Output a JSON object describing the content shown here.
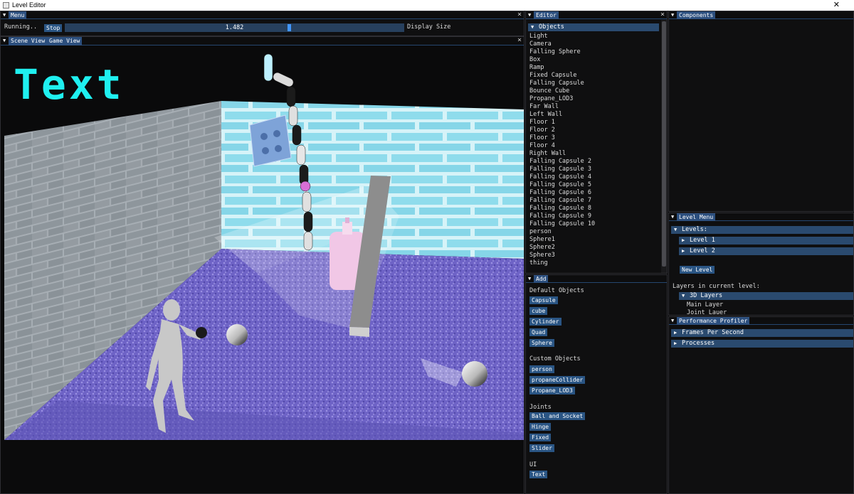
{
  "window": {
    "title": "Level Editor",
    "close": "✕"
  },
  "menu_panel": {
    "tab": "Menu",
    "status": "Running..",
    "stop_label": "Stop",
    "slider_value": "1.482",
    "slider_fraction": 0.66,
    "display_size_label": "Display Size"
  },
  "scene": {
    "tabs": [
      "Scene View",
      "Game View"
    ],
    "overlay_text": "Text",
    "accent": "#2c4f7e"
  },
  "editor": {
    "tab": "Editor",
    "objects_header": "Objects",
    "objects": [
      "Light",
      "Camera",
      "Falling Sphere",
      "Box",
      "Ramp",
      "Fixed Capsule",
      "Falling Capsule",
      "Bounce Cube",
      "Propane_LOD3",
      "Far Wall",
      "Left Wall",
      "Floor 1",
      "Floor 2",
      "Floor 3",
      "Floor 4",
      "Right Wall",
      "Falling Capsule 2",
      "Falling Capsule 3",
      "Falling Capsule 4",
      "Falling Capsule 5",
      "Falling Capsule 6",
      "Falling Capsule 7",
      "Falling Capsule 8",
      "Falling Capsule 9",
      "Falling Capsule 10",
      "person",
      "Sphere1",
      "Sphere2",
      "Sphere3",
      "thing"
    ]
  },
  "add": {
    "tab": "Add",
    "default_title": "Default Objects",
    "default_items": [
      "Capsule",
      "cube",
      "Cylinder",
      "Quad",
      "Sphere"
    ],
    "custom_title": "Custom Objects",
    "custom_items": [
      "person",
      "propaneCollider",
      "Propane_LOD3"
    ],
    "joints_title": "Joints",
    "joint_items": [
      "Ball and Socket",
      "Hinge",
      "Fixed",
      "Slider"
    ],
    "ui_title": "UI",
    "ui_items": [
      "Text"
    ]
  },
  "components": {
    "tab": "Components"
  },
  "level_menu": {
    "tab": "Level Menu",
    "levels_header": "Levels:",
    "levels": [
      "Level 1",
      "Level 2"
    ],
    "new_level": "New Level",
    "layers_title": "Layers in current level:",
    "layers_header": "3D Layers",
    "layers": [
      "Main Layer",
      "Joint Lauer"
    ]
  },
  "profiler": {
    "tab": "Performance Profiler",
    "items": [
      "Frames Per Second",
      "Processes"
    ]
  }
}
